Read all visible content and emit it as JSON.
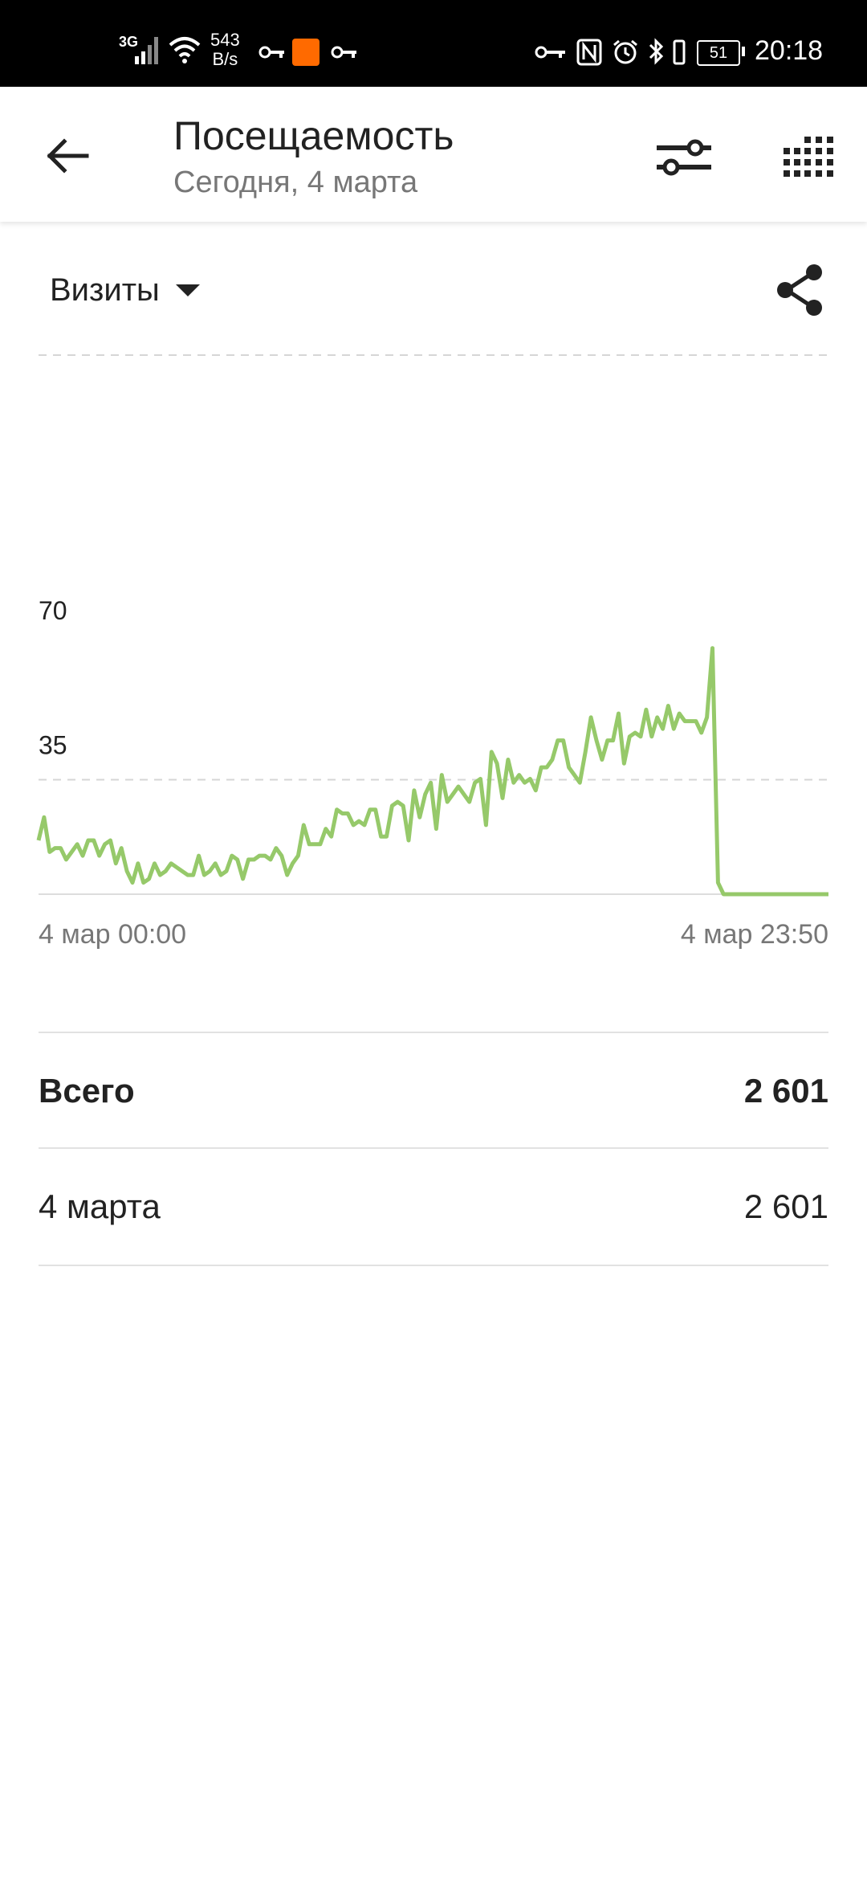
{
  "status_bar": {
    "network": "3G",
    "speed_value": "543",
    "speed_unit": "B/s",
    "battery": "51",
    "time": "20:18"
  },
  "app_bar": {
    "title": "Посещаемость",
    "subtitle": "Сегодня, 4 марта",
    "icons": [
      "back-arrow-icon",
      "filter-sliders-icon",
      "grid-dots-icon"
    ]
  },
  "metric_selector": {
    "label": "Визиты",
    "icon": "caret-down-icon"
  },
  "share_icon": "share-icon",
  "chart_data": {
    "type": "line",
    "title": "",
    "xlabel": "",
    "ylabel": "",
    "ylim": [
      0,
      80
    ],
    "y_ticks": [
      "70",
      "35"
    ],
    "x_tick_labels": [
      "4 мар 00:00",
      "4 мар 23:50"
    ],
    "grid": true,
    "color": "#96c96a",
    "series": [
      {
        "values": [
          14,
          20,
          11,
          12,
          12,
          9,
          11,
          13,
          10,
          14,
          14,
          10,
          13,
          14,
          8,
          12,
          6,
          3,
          8,
          3,
          4,
          8,
          5,
          6,
          8,
          7,
          6,
          5,
          5,
          10,
          5,
          6,
          8,
          5,
          6,
          10,
          9,
          4,
          9,
          9,
          10,
          10,
          9,
          12,
          10,
          5,
          8,
          10,
          18,
          13,
          13,
          13,
          17,
          15,
          22,
          21,
          21,
          18,
          19,
          18,
          22,
          22,
          15,
          15,
          23,
          24,
          23,
          14,
          27,
          20,
          26,
          29,
          17,
          31,
          24,
          26,
          28,
          26,
          24,
          29,
          30,
          18,
          37,
          34,
          25,
          35,
          29,
          31,
          29,
          30,
          27,
          33,
          33,
          35,
          40,
          40,
          33,
          31,
          29,
          37,
          46,
          40,
          35,
          40,
          40,
          47,
          34,
          41,
          42,
          41,
          48,
          41,
          46,
          43,
          49,
          43,
          47,
          45,
          45,
          45,
          42,
          46,
          64,
          3,
          0,
          0,
          0,
          0,
          0,
          0,
          0,
          0,
          0,
          0,
          0,
          0,
          0,
          0,
          0,
          0,
          0,
          0,
          0,
          0
        ]
      }
    ]
  },
  "summary": {
    "total_label": "Всего",
    "total_value": "2 601",
    "day_label": "4 марта",
    "day_value": "2 601"
  }
}
